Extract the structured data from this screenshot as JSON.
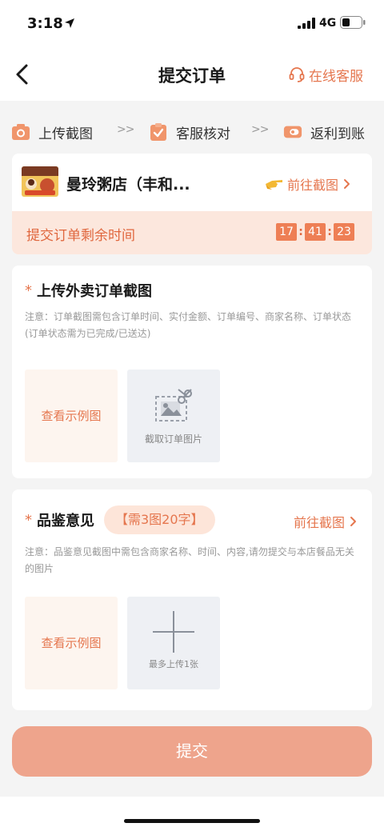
{
  "status_bar": {
    "time": "3:18",
    "network": "4G"
  },
  "nav": {
    "title": "提交订单",
    "service_label": "在线客服"
  },
  "steps": [
    {
      "label": "上传截图",
      "icon": "camera-icon"
    },
    {
      "label": "客服核对",
      "icon": "clipboard-check-icon"
    },
    {
      "label": "返利到账",
      "icon": "coin-ticket-icon"
    }
  ],
  "step_separator": ">>",
  "shop": {
    "name": "曼玲粥店（丰和...",
    "goto_label": "前往截图",
    "countdown_label": "提交订单剩余时间",
    "timer": {
      "hours": "17",
      "minutes": "41",
      "seconds": "23"
    }
  },
  "upload_section": {
    "required_mark": "*",
    "title": "上传外卖订单截图",
    "note": "注意：订单截图需包含订单时间、实付金额、订单编号、商家名称、订单状态(订单状态需为已完成/已送达)",
    "example_label": "查看示例图",
    "upload_caption": "截取订单图片"
  },
  "review_section": {
    "required_mark": "*",
    "title": "品鉴意见",
    "badge": "【需3图20字】",
    "goto_label": "前往截图",
    "note": "注意：品鉴意见截图中需包含商家名称、时间、内容,请勿提交与本店餐品无关的图片",
    "example_label": "查看示例图",
    "upload_caption": "最多上传1张"
  },
  "submit_label": "提交",
  "colors": {
    "accent": "#e5764e",
    "submit_bg": "#eea48c",
    "countdown_bg": "#fce7dd",
    "timer_box": "#ee7f55"
  }
}
